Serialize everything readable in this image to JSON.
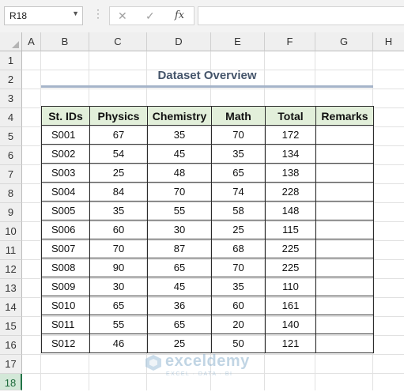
{
  "formula_bar": {
    "name_box": "R18",
    "fx_label": "fx",
    "formula": ""
  },
  "columns": [
    "A",
    "B",
    "C",
    "D",
    "E",
    "F",
    "G",
    "H"
  ],
  "rows": [
    "1",
    "2",
    "3",
    "4",
    "5",
    "6",
    "7",
    "8",
    "9",
    "10",
    "11",
    "12",
    "13",
    "14",
    "15",
    "16",
    "17",
    "18"
  ],
  "selected_row": "18",
  "sheet": {
    "title": "Dataset Overview",
    "headers": [
      "St. IDs",
      "Physics",
      "Chemistry",
      "Math",
      "Total",
      "Remarks"
    ],
    "records": [
      [
        "S001",
        "67",
        "35",
        "70",
        "172",
        ""
      ],
      [
        "S002",
        "54",
        "45",
        "35",
        "134",
        ""
      ],
      [
        "S003",
        "25",
        "48",
        "65",
        "138",
        ""
      ],
      [
        "S004",
        "84",
        "70",
        "74",
        "228",
        ""
      ],
      [
        "S005",
        "35",
        "55",
        "58",
        "148",
        ""
      ],
      [
        "S006",
        "60",
        "30",
        "25",
        "115",
        ""
      ],
      [
        "S007",
        "70",
        "87",
        "68",
        "225",
        ""
      ],
      [
        "S008",
        "90",
        "65",
        "70",
        "225",
        ""
      ],
      [
        "S009",
        "30",
        "45",
        "35",
        "110",
        ""
      ],
      [
        "S010",
        "65",
        "36",
        "60",
        "161",
        ""
      ],
      [
        "S011",
        "55",
        "65",
        "20",
        "140",
        ""
      ],
      [
        "S012",
        "46",
        "25",
        "50",
        "121",
        ""
      ]
    ]
  },
  "watermark": {
    "name": "exceldemy",
    "tagline": "EXCEL · DATA · BI"
  },
  "colors": {
    "header_fill": "#e2efda",
    "title_color": "#44546a",
    "selected_row_accent": "#217346"
  }
}
